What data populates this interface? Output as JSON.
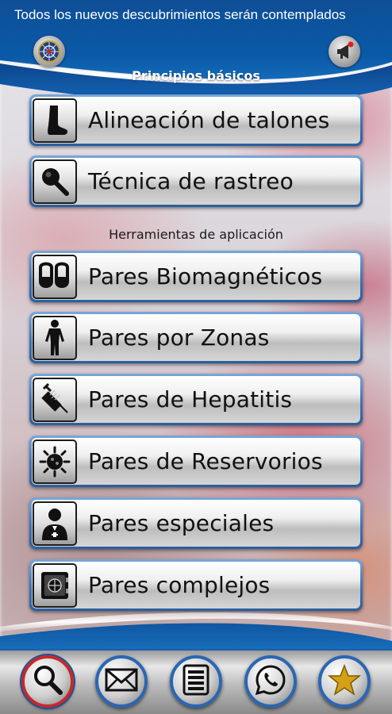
{
  "header": {
    "ticker_text": "Todos los nuevos descubrimientos serán contemplados",
    "left_icon": "emblem-icon",
    "right_icon": "megaphone-icon"
  },
  "sections": {
    "basic_title": "Principios básicos",
    "tools_title": "Herramientas de aplicación"
  },
  "basic_items": [
    {
      "label": "Alineación de talones",
      "icon": "foot-icon"
    },
    {
      "label": "Técnica de rastreo",
      "icon": "magnifier-icon"
    }
  ],
  "tool_items": [
    {
      "label": "Pares Biomagnéticos",
      "icon": "magnets-icon"
    },
    {
      "label": "Pares por Zonas",
      "icon": "body-icon"
    },
    {
      "label": "Pares de Hepatitis",
      "icon": "syringe-icon"
    },
    {
      "label": "Pares de Reservorios",
      "icon": "virus-icon"
    },
    {
      "label": "Pares especiales",
      "icon": "doctor-icon"
    },
    {
      "label": "Pares complejos",
      "icon": "safe-icon"
    }
  ],
  "footer": {
    "buttons": [
      "search-icon",
      "mail-icon",
      "list-icon",
      "whatsapp-icon",
      "star-icon"
    ],
    "active_index": 0
  },
  "colors": {
    "header_blue": "#0e4e96",
    "accent_blue": "#2a66b3",
    "active_ring": "#c62828",
    "star_gold": "#d4a017"
  }
}
